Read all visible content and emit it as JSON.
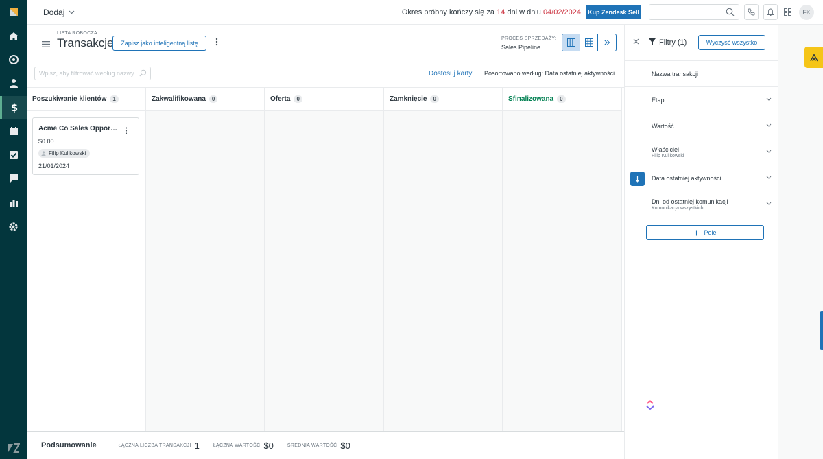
{
  "topbar": {
    "add_label": "Dodaj",
    "trial_prefix": "Okres próbny kończy się za ",
    "trial_days": "14",
    "trial_middle": " dni w dniu ",
    "trial_date": "04/02/2024",
    "buy_label": "Kup Zendesk Sell",
    "user_initials": "FK"
  },
  "header": {
    "eyebrow": "LISTA ROBOCZA",
    "title": "Transakcje",
    "save_smart_label": "Zapisz jako inteligentną listę",
    "process_label": "PROCES SPRZEDAŻY:",
    "process_value": "Sales Pipeline",
    "filter_placeholder": "Wpisz, aby filtrować według nazwy",
    "customize_label": "Dostosuj karty",
    "sorted_label": "Posortowano według: Data ostatniej aktywności"
  },
  "board": {
    "columns": [
      {
        "name": "Poszukiwanie klientów",
        "count": "1"
      },
      {
        "name": "Zakwalifikowana",
        "count": "0"
      },
      {
        "name": "Oferta",
        "count": "0"
      },
      {
        "name": "Zamknięcie",
        "count": "0"
      },
      {
        "name": "Sfinalizowana",
        "count": "0"
      }
    ],
    "card": {
      "name": "Acme Co Sales Opportunity",
      "value": "$0.00",
      "owner": "Filip Kulikowski",
      "date": "21/01/2024"
    }
  },
  "footer": {
    "title": "Podsumowanie",
    "total_count_label": "ŁĄCZNA LICZBA TRANSAKCJI",
    "total_count": "1",
    "total_value_label": "ŁĄCZNA WARTOŚĆ",
    "total_value": "$0",
    "avg_value_label": "ŚREDNIA WARTOŚĆ",
    "avg_value": "$0"
  },
  "filters": {
    "title": "Filtry (1)",
    "clear_label": "Wyczyść wszystko",
    "rows": [
      {
        "label": "Nazwa transakcji"
      },
      {
        "label": "Etap"
      },
      {
        "label": "Wartość"
      },
      {
        "label": "Właściciel",
        "sub": "Filip Kulikowski"
      },
      {
        "label": "Data ostatniej aktywności"
      },
      {
        "label": "Dni od ostatniej komunikacji",
        "sub": "Komunikacja wszystkich"
      }
    ],
    "add_field_label": "Pole"
  },
  "colors": {
    "nav_bg": "#03363d",
    "accent": "#1f73b7",
    "finalized": "#038153",
    "trial_red": "#cc3340"
  },
  "nav_icons": [
    "sell-logo-icon",
    "home-icon",
    "leads-icon",
    "contacts-icon",
    "deals-icon",
    "calendar-icon",
    "tasks-icon",
    "communication-icon",
    "reports-icon",
    "settings-icon",
    "zendesk-logo-icon"
  ]
}
